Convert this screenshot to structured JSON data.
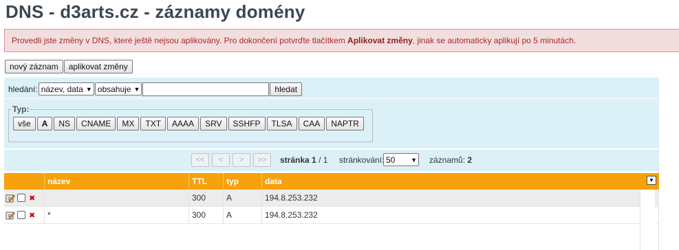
{
  "page": {
    "title": "DNS - d3arts.cz - záznamy domény"
  },
  "alert": {
    "text_before": "Provedli jste změny v DNS, které ještě nejsou aplikovány. Pro dokončení potvrďte tlačítkem ",
    "bold": "Aplikovat změny",
    "text_after": ", jinak se automaticky aplikují po 5 minutách."
  },
  "toolbar": {
    "new_record": "nový záznam",
    "apply_changes": "aplikovat změny"
  },
  "search": {
    "label": "hledání:",
    "field_select": "název, data",
    "operator_select": "obsahuje",
    "query": "",
    "button": "hledat"
  },
  "type_filter": {
    "legend": "Typ:",
    "buttons": [
      "vše",
      "A",
      "NS",
      "CNAME",
      "MX",
      "TXT",
      "AAAA",
      "SRV",
      "SSHFP",
      "TLSA",
      "CAA",
      "NAPTR"
    ],
    "active": "A"
  },
  "pager": {
    "first": "<<",
    "prev": "<",
    "next": ">",
    "last": ">>",
    "page_label": "stránka",
    "current_page": "1",
    "total_pages": "1",
    "paging_label": "stránkování:",
    "page_size": "50",
    "records_label": "záznamů:",
    "records_count": "2"
  },
  "table": {
    "headers": [
      "název",
      "TTL",
      "typ",
      "data"
    ],
    "rows": [
      {
        "name": "",
        "ttl": "300",
        "type": "A",
        "data": "194.8.253.232"
      },
      {
        "name": "*",
        "ttl": "300",
        "type": "A",
        "data": "194.8.253.232"
      }
    ]
  },
  "colors": {
    "header_orange": "#f7a10c",
    "panel_blue": "#dcf0f8",
    "alert_bg": "#f2dede",
    "alert_text": "#a52a2a"
  }
}
